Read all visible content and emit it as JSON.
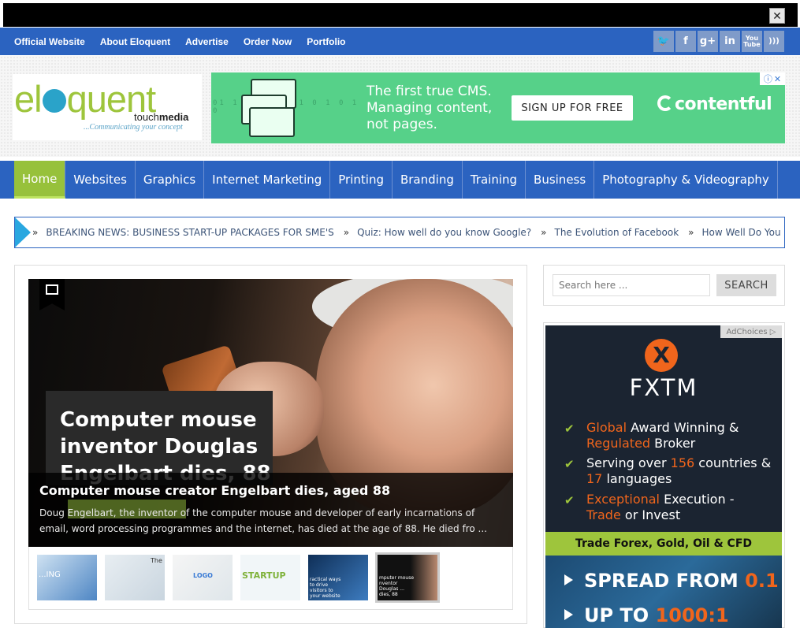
{
  "top_links": [
    "Official Website",
    "About Eloquent",
    "Advertise",
    "Order Now",
    "Portfolio"
  ],
  "social_icons": [
    "twitter-icon",
    "facebook-icon",
    "google-plus-icon",
    "linkedin-icon",
    "youtube-icon",
    "rss-icon"
  ],
  "social_glyphs": [
    "🐦",
    "f",
    "g+",
    "in",
    "You\nTube",
    ")))"
  ],
  "close_glyph": "✕",
  "logo": {
    "prefix": "el",
    "suffix": "quent",
    "sub_a": "touch",
    "sub_b": "media",
    "tagline": "...Communicating your concept"
  },
  "banner_ad": {
    "line1": "The first true CMS.",
    "line2": "Managing content,",
    "line3": "not pages.",
    "cta": "SIGN UP FOR FREE",
    "brand": "contentful",
    "bits": "01 1 0   0 1 0 1 0 1 0 1 0"
  },
  "main_nav": [
    "Home",
    "Websites",
    "Graphics",
    "Internet Marketing",
    "Printing",
    "Branding",
    "Training",
    "Business",
    "Photography & Videography"
  ],
  "ticker": [
    "BREAKING NEWS: BUSINESS START-UP PACKAGES FOR SME'S",
    "Quiz: How well do you know Google?",
    "The Evolution of Facebook",
    "How Well Do You Kn"
  ],
  "ticker_sep": "»",
  "slider": {
    "sign_text": "Computer mouse inventor Douglas Engelbart dies, 88",
    "title": "Computer mouse creator Engelbart dies, aged 88",
    "excerpt": "Doug Engelbart, the inventor of the computer mouse and developer of early incarnations of email, word processing programmes and the internet, has died at the age of 88. He died fro ..."
  },
  "thumbnails": [
    {
      "label": "...ING",
      "color": "#9cc3e6"
    },
    {
      "label": "The",
      "color": "#d9e3ea"
    },
    {
      "label": "LOGO",
      "color": "#e9edef"
    },
    {
      "label": "STARTUP",
      "color": "#eef4f6"
    },
    {
      "label": "ractical ways to drive visitors to your website",
      "color": "#20508a"
    },
    {
      "label": "mputer mouse nventor Douglas ... dies, 88",
      "color": "#1b1b1b"
    }
  ],
  "search": {
    "placeholder": "Search here ...",
    "button": "SEARCH"
  },
  "side_ad": {
    "adchoices": "AdChoices ▷",
    "brand": "FXTM",
    "check": "✔",
    "rows": [
      {
        "o1": "Global",
        "t1": " Award Winning &",
        "o2": "Regulated",
        "t2": " Broker"
      },
      {
        "o1": "",
        "t1": "Serving over ",
        "o2": "156",
        "t2": " countries &",
        "o3": "17",
        "t3": " languages"
      },
      {
        "o1": "Exceptional",
        "t1": " Execution -",
        "o2": "Trade",
        "t2": " or Invest"
      }
    ],
    "trade_bar": "Trade Forex, Gold, Oil & CFD",
    "spread_label": "SPREAD FROM ",
    "spread_value": "0.1",
    "upto_label": "UP TO ",
    "upto_value": "1000:1"
  },
  "ad_corner": [
    "ⓘ",
    "✕"
  ]
}
